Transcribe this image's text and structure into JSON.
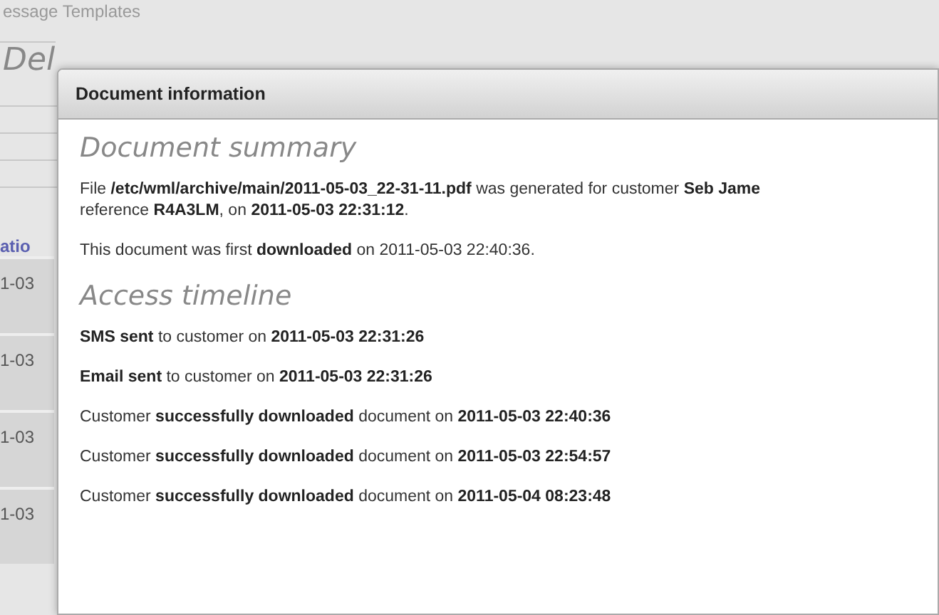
{
  "background_page": {
    "breadcrumb": "essage Templates",
    "heading": "Del",
    "column_header": "atio",
    "cells": [
      "1-03",
      "1-03",
      "1-03",
      "1-03"
    ]
  },
  "dialog": {
    "title": "Document information",
    "sections": [
      {
        "heading": "Document summary",
        "paragraphs": [
          {
            "lines": [
              "File **/etc/wml/archive/main/2011-05-03_22-31-11.pdf** was generated for customer **Seb Jame**",
              "reference **R4A3LM**, on **2011-05-03 22:31:12**."
            ]
          },
          {
            "lines": [
              "This document was first **downloaded** on 2011-05-03 22:40:36."
            ]
          }
        ]
      },
      {
        "heading": "Access timeline",
        "paragraphs": [
          {
            "lines": [
              "**SMS sent** to customer on **2011-05-03 22:31:26**"
            ]
          },
          {
            "lines": [
              "**Email sent** to customer on **2011-05-03 22:31:26**"
            ]
          },
          {
            "lines": [
              "Customer **successfully downloaded** document on **2011-05-03 22:40:36**"
            ]
          },
          {
            "lines": [
              "Customer **successfully downloaded** document on **2011-05-03 22:54:57**"
            ]
          },
          {
            "lines": [
              "Customer **successfully downloaded** document on **2011-05-04 08:23:48**"
            ]
          }
        ]
      }
    ]
  }
}
